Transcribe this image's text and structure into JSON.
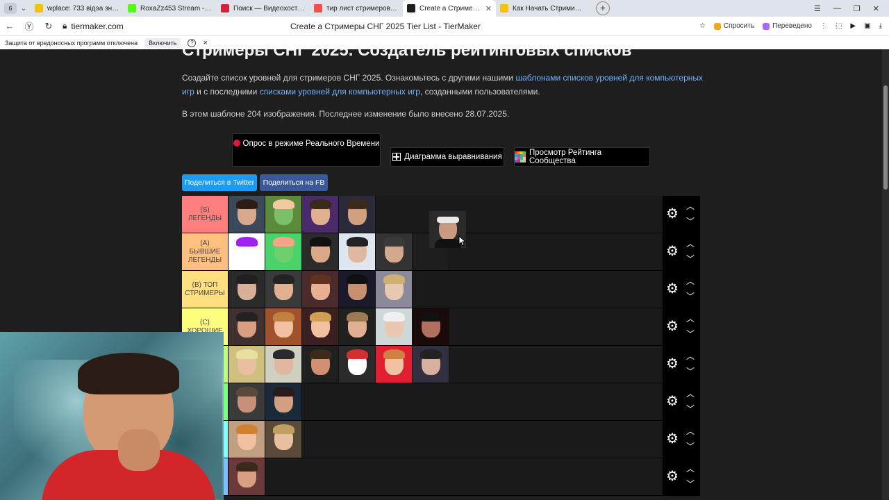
{
  "browser": {
    "tab_count": "6",
    "tabs": [
      {
        "title": "wplace: 733 відэа знойдз",
        "color": "#f4c20d",
        "active": false
      },
      {
        "title": "RoxaZz453 Stream - Watc",
        "color": "#53fc18",
        "active": false
      },
      {
        "title": "Поиск — Видеохостинг R",
        "color": "#d1243b",
        "active": false
      },
      {
        "title": "тир лист стримеров твич",
        "color": "#f24e4e",
        "active": false
      },
      {
        "title": "Create a Стримеры СН",
        "color": "#1e1e1e",
        "active": true
      },
      {
        "title": "Как Начать Стримить на",
        "color": "#f4c20d",
        "active": false
      }
    ],
    "new_tab": "+",
    "url": "tiermaker.com",
    "page_title": "Create a Стримеры СНГ 2025 Tier List - TierMaker",
    "ask_label": "Спросить",
    "translated_label": "Переведено",
    "protection_text": "Защита от вредоносных программ отключена",
    "enable_label": "Включить",
    "help": "?",
    "close": "×"
  },
  "page": {
    "heading": "Стримеры СНГ 2025. Создатель рейтинговых списков",
    "intro_part1": "Создайте список уровней для стримеров СНГ 2025. Ознакомьтесь с другими нашими ",
    "intro_link1": "шаблонами списков уровней для компьютерных игр",
    "intro_part2": " и с последними ",
    "intro_link2": "списками уровней для компьютерных игр",
    "intro_part3": ", созданными пользователями.",
    "meta": "В этом шаблоне 204 изображения. Последнее изменение было внесено 28.07.2025.",
    "live_poll_label": "Опрос в режиме Реального Времени",
    "alignment_label": "Диаграмма выравнивания",
    "community_label": "Просмотр Рейтинга Сообщества",
    "share_twitter": "Поделиться в Twitter",
    "share_fb": "Поделиться на FB"
  },
  "tiers": [
    {
      "label": "(S) ЛЕГЕНДЫ",
      "color": "#ff7f7f",
      "count": 4
    },
    {
      "label": "(A) БЫВШИЕ ЛЕГЕНДЫ",
      "color": "#ffbf7f",
      "count": 5
    },
    {
      "label": "(B) ТОП СТРИМЕРЫ",
      "color": "#ffdf7f",
      "count": 5
    },
    {
      "label": "(C) ХОРОШИЕ",
      "color": "#ffff7f",
      "count": 6
    },
    {
      "label": "",
      "color": "#bfff7f",
      "count": 6
    },
    {
      "label": "",
      "color": "#7fff7f",
      "count": 2
    },
    {
      "label": "",
      "color": "#7fffff",
      "count": 2
    },
    {
      "label": "",
      "color": "#7fbfff",
      "count": 1
    }
  ],
  "colors": {
    "accent_link": "#6fb2ff",
    "twitter": "#1d9bf0",
    "facebook": "#3b5998",
    "live_dot": "#e0183b"
  }
}
